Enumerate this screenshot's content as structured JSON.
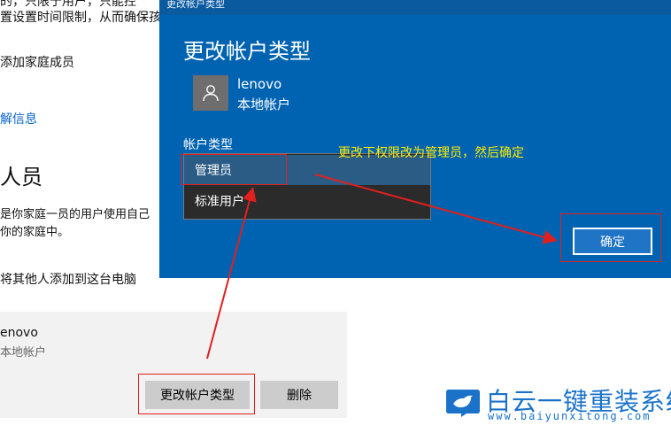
{
  "background": {
    "line1": "的，只限于用户，只能控",
    "line2": "置设置时间限制，从而确保孩",
    "add_family_member": "添加家庭成员",
    "more_info_link": "解信息",
    "other_people_heading": "人员",
    "desc_line1": "是你家庭一员的用户使用自己",
    "desc_line2": "你的家庭中。",
    "add_other_person": "将其他人添加到这台电脑",
    "account_tile": {
      "name": "enovo",
      "type": "本地帐户",
      "change_type_button": "更改帐户类型",
      "delete_button": "删除"
    }
  },
  "dialog": {
    "titlebar": "更改帐户类型",
    "title": "更改帐户类型",
    "user_name": "lenovo",
    "user_type": "本地帐户",
    "account_type_label": "帐户类型",
    "options": [
      "管理员",
      "标准用户"
    ],
    "selected_option": "管理员",
    "ok_button": "确定"
  },
  "annotation": {
    "text": "更改下权限改为管理员，然后确定",
    "color": "#ffee00",
    "highlight_color": "#e0201e"
  },
  "watermark": {
    "title": "白云一键重装系统",
    "url": "www.baiyunxitong.com",
    "color": "#1a72c9"
  },
  "colors": {
    "dialog_bg": "#0063b1",
    "dropdown_bg": "#2b2b2b",
    "selected_bg": "#2b5c86"
  }
}
